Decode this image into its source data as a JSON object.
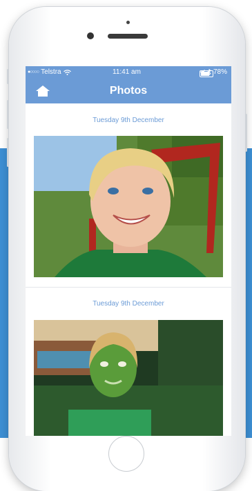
{
  "status_bar": {
    "carrier": "Telstra",
    "time": "11:41 am",
    "battery": "78%"
  },
  "nav": {
    "title": "Photos",
    "home_icon": "home-icon"
  },
  "feed": [
    {
      "date": "Tuesday 9th December",
      "photo": "Smiling blond toddler outdoors"
    },
    {
      "date": "Tuesday 9th December",
      "photo": "Child with green face paint"
    }
  ],
  "colors": {
    "accent": "#6b9bd6",
    "background_band": "#3d8fd4"
  }
}
